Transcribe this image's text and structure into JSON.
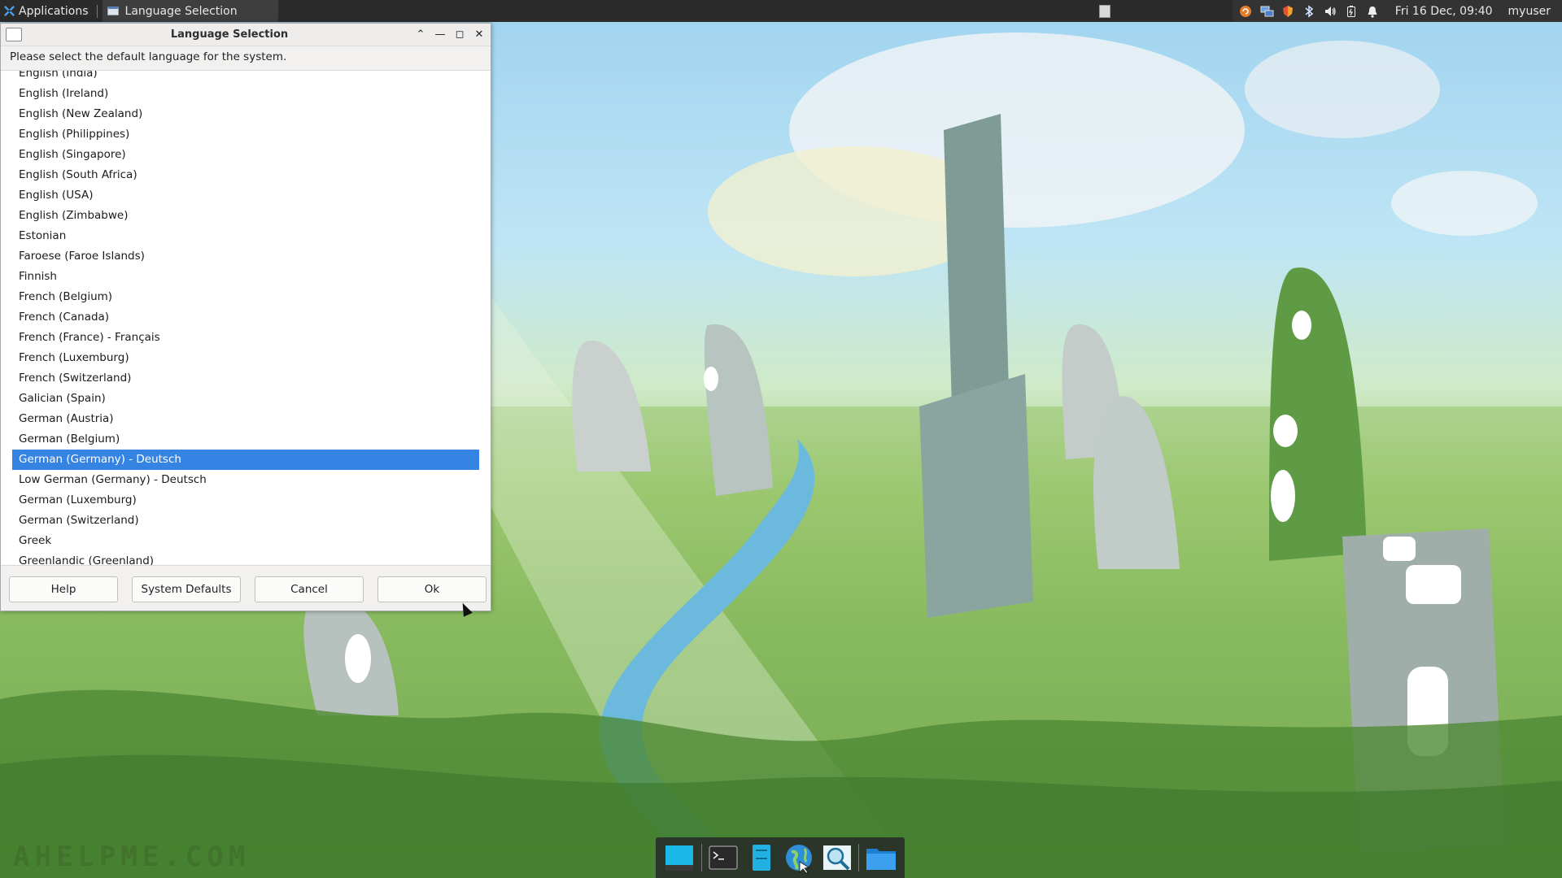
{
  "top_panel": {
    "applications_label": "Applications",
    "task_title": "Language Selection",
    "clock": "Fri 16 Dec, 09:40",
    "user": "myuser",
    "tray_icons": [
      "updates-icon",
      "network-icon",
      "shield-icon",
      "bluetooth-icon",
      "volume-icon",
      "battery-icon",
      "notification-icon"
    ]
  },
  "dialog": {
    "title": "Language Selection",
    "prompt": "Please select the default language for the system.",
    "languages": [
      "English (India)",
      "English (Ireland)",
      "English (New Zealand)",
      "English (Philippines)",
      "English (Singapore)",
      "English (South Africa)",
      "English (USA)",
      "English (Zimbabwe)",
      "Estonian",
      "Faroese (Faroe Islands)",
      "Finnish",
      "French (Belgium)",
      "French (Canada)",
      "French (France) - Français",
      "French (Luxemburg)",
      "French (Switzerland)",
      "Galician (Spain)",
      "German (Austria)",
      "German (Belgium)",
      "German (Germany) - Deutsch",
      "Low German (Germany) - Deutsch",
      "German (Luxemburg)",
      "German (Switzerland)",
      "Greek",
      "Greenlandic (Greenland)"
    ],
    "selected_index": 19,
    "buttons": {
      "help": "Help",
      "system_defaults": "System Defaults",
      "cancel": "Cancel",
      "ok": "Ok"
    },
    "selection_color": "#3584e4"
  },
  "dock": {
    "items": [
      "desktop-icon",
      "terminal-icon",
      "file-manager-icon",
      "web-browser-icon",
      "search-icon",
      "folder-icon"
    ]
  },
  "watermark": "AHELPME.COM"
}
